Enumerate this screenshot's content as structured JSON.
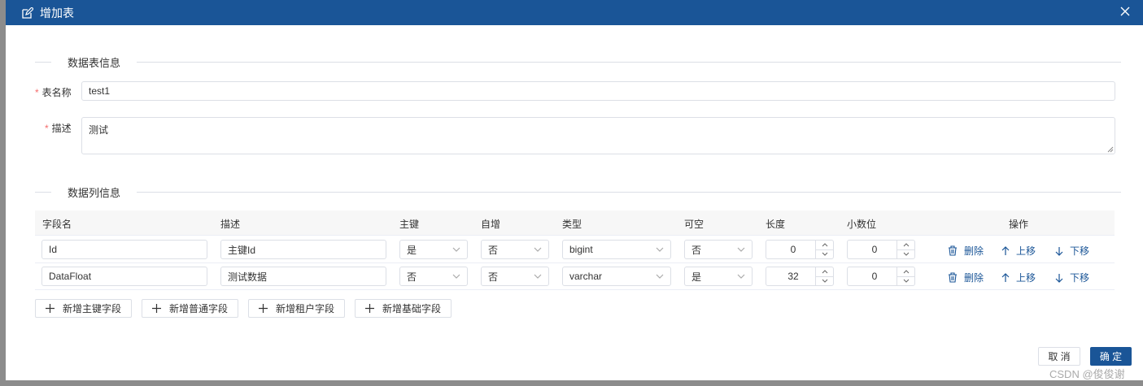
{
  "dialog": {
    "title": "增加表",
    "section_table": "数据表信息",
    "section_columns": "数据列信息"
  },
  "form": {
    "name_label": "表名称",
    "name_value": "test1",
    "desc_label": "描述",
    "desc_value": "测试",
    "required_mark": "*"
  },
  "table": {
    "headers": [
      "字段名",
      "描述",
      "主键",
      "自增",
      "类型",
      "可空",
      "长度",
      "小数位",
      "操作"
    ],
    "rows": [
      {
        "field": "Id",
        "desc": "主键Id",
        "pk": "是",
        "auto": "否",
        "type": "bigint",
        "nullable": "否",
        "length": "0",
        "decimal": "0"
      },
      {
        "field": "DataFloat",
        "desc": "测试数据",
        "pk": "否",
        "auto": "否",
        "type": "varchar",
        "nullable": "是",
        "length": "32",
        "decimal": "0"
      }
    ],
    "actions": {
      "delete": "删除",
      "up": "上移",
      "down": "下移"
    }
  },
  "buttons": {
    "add_pk": "新增主键字段",
    "add_normal": "新增普通字段",
    "add_tenant": "新增租户字段",
    "add_base": "新增基础字段",
    "cancel": "取 消",
    "ok": "确 定"
  },
  "watermark": "CSDN @俊俊谢",
  "colors": {
    "primary": "#1a5597",
    "required": "#f56c6c"
  },
  "icons": [
    "edit-icon",
    "close-icon",
    "chevron-down-icon",
    "trash-icon",
    "arrow-up-icon",
    "arrow-down-icon",
    "plus-icon"
  ]
}
